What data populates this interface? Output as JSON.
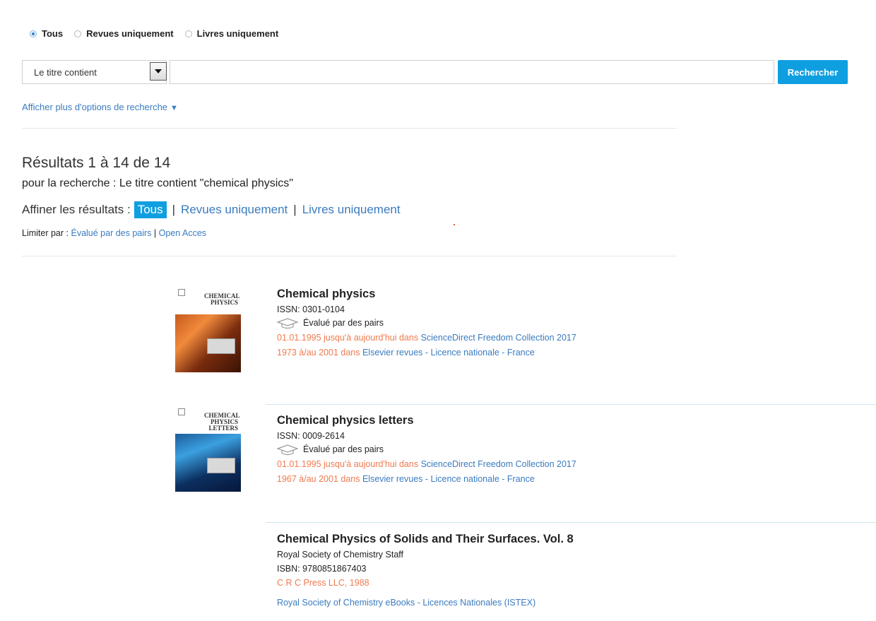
{
  "filter_radios": [
    {
      "label": "Tous",
      "checked": true
    },
    {
      "label": "Revues uniquement",
      "checked": false
    },
    {
      "label": "Livres uniquement",
      "checked": false
    }
  ],
  "search": {
    "field_selected": "Le titre contient",
    "query_value": "",
    "button_label": "Rechercher"
  },
  "more_options": {
    "label": "Afficher plus d'options de recherche",
    "icon": "triangle-down-icon"
  },
  "results": {
    "title": "Résultats 1 à 14 de 14",
    "subtitle": "pour la recherche : Le titre contient \"chemical physics\""
  },
  "refine": {
    "label": "Affiner les résultats :",
    "active": "Tous",
    "options": [
      "Revues uniquement",
      "Livres uniquement"
    ]
  },
  "limit": {
    "label": "Limiter par :",
    "options": [
      "Évalué par des pairs",
      "Open Acces"
    ]
  },
  "items": [
    {
      "title": "Chemical physics",
      "id_line": "ISSN: 0301-0104",
      "peer": "Évalué par des pairs",
      "cover_title": "CHEMICAL PHYSICS",
      "holdings": [
        {
          "range": "01.01.1995 jusqu'à aujourd'hui dans",
          "source": "ScienceDirect Freedom Collection 2017"
        },
        {
          "range": "1973 à/au 2001 dans",
          "source": "Elsevier revues - Licence nationale - France"
        }
      ]
    },
    {
      "title": "Chemical physics letters",
      "id_line": "ISSN: 0009-2614",
      "peer": "Évalué par des pairs",
      "cover_title": "CHEMICAL PHYSICS LETTERS",
      "holdings": [
        {
          "range": "01.01.1995 jusqu'à aujourd'hui dans",
          "source": "ScienceDirect Freedom Collection 2017"
        },
        {
          "range": "1967 à/au 2001 dans",
          "source": "Elsevier revues - Licence nationale - France"
        }
      ]
    },
    {
      "title": "Chemical Physics of Solids and Their Surfaces. Vol. 8",
      "author": "Royal Society of Chemistry Staff",
      "id_line": "ISBN: 9780851867403",
      "publisher": "C R C Press LLC, 1988",
      "source": "Royal Society of Chemistry eBooks - Licences Nationales (ISTEX)"
    }
  ]
}
